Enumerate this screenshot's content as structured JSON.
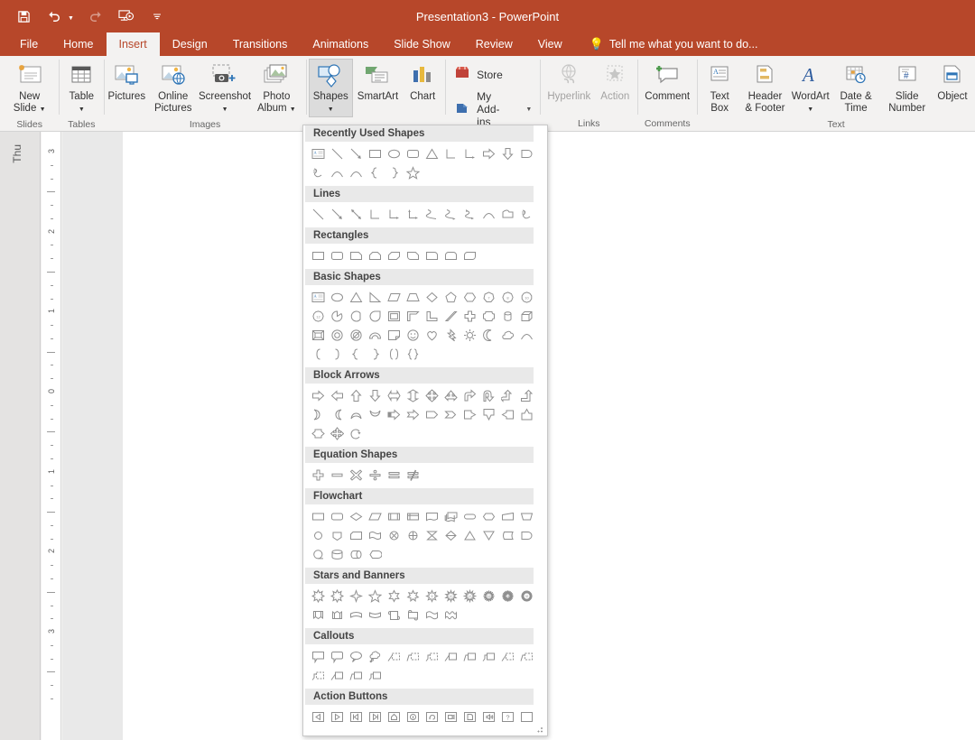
{
  "titlebar": {
    "title": "Presentation3 - PowerPoint",
    "qat": [
      {
        "name": "save-icon",
        "label": "Save"
      },
      {
        "name": "undo-icon",
        "label": "Undo"
      },
      {
        "name": "redo-icon",
        "label": "Redo"
      },
      {
        "name": "start-slideshow-icon",
        "label": "Start From Beginning"
      },
      {
        "name": "customize-qat-icon",
        "label": "Customize Quick Access Toolbar"
      }
    ]
  },
  "tabs": [
    {
      "label": "File",
      "active": false
    },
    {
      "label": "Home",
      "active": false
    },
    {
      "label": "Insert",
      "active": true
    },
    {
      "label": "Design",
      "active": false
    },
    {
      "label": "Transitions",
      "active": false
    },
    {
      "label": "Animations",
      "active": false
    },
    {
      "label": "Slide Show",
      "active": false
    },
    {
      "label": "Review",
      "active": false
    },
    {
      "label": "View",
      "active": false
    }
  ],
  "tellme": "Tell me what you want to do...",
  "ribbon": {
    "groups": [
      {
        "name": "slides",
        "label": "Slides",
        "buttons": [
          {
            "label": "New Slide",
            "caret": true,
            "icon": "new-slide-icon",
            "disabled": false,
            "active": false
          }
        ]
      },
      {
        "name": "tables",
        "label": "Tables",
        "buttons": [
          {
            "label": "Table",
            "caret": true,
            "icon": "table-icon",
            "disabled": false,
            "active": false
          }
        ]
      },
      {
        "name": "images",
        "label": "Images",
        "buttons": [
          {
            "label": "Pictures",
            "caret": false,
            "icon": "pictures-icon",
            "disabled": false,
            "active": false
          },
          {
            "label": "Online Pictures",
            "caret": false,
            "icon": "online-pictures-icon",
            "disabled": false,
            "active": false
          },
          {
            "label": "Screenshot",
            "caret": true,
            "icon": "screenshot-icon",
            "disabled": false,
            "active": false
          },
          {
            "label": "Photo Album",
            "caret": true,
            "icon": "photo-album-icon",
            "disabled": false,
            "active": false
          }
        ]
      },
      {
        "name": "illustrations",
        "label": "",
        "buttons": [
          {
            "label": "Shapes",
            "caret": true,
            "icon": "shapes-icon",
            "disabled": false,
            "active": true
          },
          {
            "label": "SmartArt",
            "caret": false,
            "icon": "smartart-icon",
            "disabled": false,
            "active": false
          },
          {
            "label": "Chart",
            "caret": false,
            "icon": "chart-icon",
            "disabled": false,
            "active": false
          }
        ]
      },
      {
        "name": "addins",
        "label": "",
        "small_buttons": [
          {
            "label": "Store",
            "icon": "store-icon",
            "caret": false
          },
          {
            "label": "My Add-ins",
            "icon": "my-addins-icon",
            "caret": true
          }
        ]
      },
      {
        "name": "links",
        "label": "Links",
        "buttons": [
          {
            "label": "Hyperlink",
            "caret": false,
            "icon": "hyperlink-icon",
            "disabled": true,
            "active": false
          },
          {
            "label": "Action",
            "caret": false,
            "icon": "action-icon",
            "disabled": true,
            "active": false
          }
        ]
      },
      {
        "name": "comments",
        "label": "Comments",
        "buttons": [
          {
            "label": "Comment",
            "caret": false,
            "icon": "comment-icon",
            "disabled": false,
            "active": false
          }
        ]
      },
      {
        "name": "text",
        "label": "Text",
        "buttons": [
          {
            "label": "Text Box",
            "caret": false,
            "icon": "text-box-icon",
            "disabled": false,
            "active": false
          },
          {
            "label": "Header & Footer",
            "caret": false,
            "icon": "header-footer-icon",
            "disabled": false,
            "active": false
          },
          {
            "label": "WordArt",
            "caret": true,
            "icon": "wordart-icon",
            "disabled": false,
            "active": false
          },
          {
            "label": "Date & Time",
            "caret": false,
            "icon": "date-time-icon",
            "disabled": false,
            "active": false
          },
          {
            "label": "Slide Number",
            "caret": false,
            "icon": "slide-number-icon",
            "disabled": false,
            "active": false
          },
          {
            "label": "Object",
            "caret": false,
            "icon": "object-icon",
            "disabled": false,
            "active": false
          }
        ]
      }
    ]
  },
  "workspace": {
    "thumb_pane_label": "Thu",
    "ruler_ticks": [
      "3",
      "2",
      "1",
      "0",
      "1",
      "2",
      "3"
    ]
  },
  "gallery": {
    "sections": [
      {
        "title": "Recently Used Shapes",
        "rows": [
          [
            "text-box",
            "line",
            "line-arrow",
            "rectangle",
            "oval",
            "rounded-rectangle",
            "isosceles-triangle",
            "elbow-connector",
            "elbow-arrow-connector",
            "right-arrow",
            "down-arrow",
            "flowchart-delay"
          ],
          [
            "freeform-scribble",
            "arc",
            "curve",
            "left-brace",
            "right-brace",
            "star-5-point"
          ]
        ]
      },
      {
        "title": "Lines",
        "rows": [
          [
            "line",
            "line-arrow",
            "line-double-arrow",
            "elbow-connector",
            "elbow-arrow-connector",
            "elbow-double-arrow-connector",
            "curved-connector",
            "curved-arrow-connector",
            "curved-double-arrow-connector",
            "curve",
            "freeform-shape",
            "freeform-scribble"
          ]
        ]
      },
      {
        "title": "Rectangles",
        "rows": [
          [
            "rectangle",
            "rounded-rectangle",
            "snip-single-corner-rectangle",
            "snip-same-side-corner-rectangle",
            "snip-diagonal-corner-rectangle",
            "snip-and-round-single-corner-rectangle",
            "round-single-corner-rectangle",
            "round-same-side-corner-rectangle",
            "round-diagonal-corner-rectangle"
          ]
        ]
      },
      {
        "title": "Basic Shapes",
        "rows": [
          [
            "text-box",
            "oval",
            "isosceles-triangle",
            "right-triangle",
            "parallelogram",
            "trapezoid",
            "diamond",
            "pentagon",
            "hexagon",
            "heptagon",
            "octagon",
            "decagon"
          ],
          [
            "dodecagon",
            "pie",
            "chord",
            "teardrop",
            "frame",
            "half-frame",
            "l-shape",
            "diagonal-stripe",
            "cross",
            "plaque",
            "can",
            "cube"
          ],
          [
            "bevel",
            "donut",
            "no-symbol",
            "block-arc",
            "folded-corner",
            "smiley-face",
            "heart",
            "lightning-bolt",
            "sun",
            "moon",
            "cloud",
            "arc"
          ],
          [
            "left-bracket",
            "right-bracket",
            "left-brace",
            "right-brace",
            "double-bracket",
            "double-brace"
          ]
        ]
      },
      {
        "title": "Block Arrows",
        "rows": [
          [
            "right-arrow",
            "left-arrow",
            "up-arrow",
            "down-arrow",
            "left-right-arrow",
            "up-down-arrow",
            "quad-arrow",
            "left-right-up-arrow",
            "bent-arrow",
            "u-turn-arrow",
            "left-up-arrow",
            "bent-up-arrow"
          ],
          [
            "curved-right-arrow",
            "curved-left-arrow",
            "curved-up-arrow",
            "curved-down-arrow",
            "striped-right-arrow",
            "notched-right-arrow",
            "pentagon-arrow",
            "chevron-arrow",
            "right-arrow-callout",
            "down-arrow-callout",
            "left-arrow-callout",
            "up-arrow-callout"
          ],
          [
            "left-right-arrow-callout",
            "quad-arrow-callout",
            "circular-arrow"
          ]
        ]
      },
      {
        "title": "Equation Shapes",
        "rows": [
          [
            "plus-sign",
            "minus-sign",
            "multiply-sign",
            "division-sign",
            "equal-sign",
            "not-equal-sign"
          ]
        ]
      },
      {
        "title": "Flowchart",
        "rows": [
          [
            "flowchart-process",
            "flowchart-alternate-process",
            "flowchart-decision",
            "flowchart-data",
            "flowchart-predefined-process",
            "flowchart-internal-storage",
            "flowchart-document",
            "flowchart-multidocument",
            "flowchart-terminator",
            "flowchart-preparation",
            "flowchart-manual-input",
            "flowchart-manual-operation"
          ],
          [
            "flowchart-connector",
            "flowchart-off-page-connector",
            "flowchart-card",
            "flowchart-punched-tape",
            "flowchart-summing-junction",
            "flowchart-or",
            "flowchart-collate",
            "flowchart-sort",
            "flowchart-extract",
            "flowchart-merge",
            "flowchart-stored-data",
            "flowchart-delay"
          ],
          [
            "flowchart-sequential-access-storage",
            "flowchart-magnetic-disk",
            "flowchart-direct-access-storage",
            "flowchart-display"
          ]
        ]
      },
      {
        "title": "Stars and Banners",
        "rows": [
          [
            "explosion-1",
            "explosion-2",
            "star-4-point",
            "star-5-point",
            "star-6-point",
            "star-7-point",
            "star-8-point",
            "star-10-point",
            "star-12-point",
            "star-16-point",
            "star-24-point",
            "star-32-point"
          ],
          [
            "up-ribbon",
            "down-ribbon",
            "curved-up-ribbon",
            "curved-down-ribbon",
            "vertical-scroll",
            "horizontal-scroll",
            "wave",
            "double-wave"
          ]
        ]
      },
      {
        "title": "Callouts",
        "rows": [
          [
            "rectangular-callout",
            "rounded-rectangular-callout",
            "oval-callout",
            "cloud-callout",
            "line-callout-1",
            "line-callout-2",
            "line-callout-3",
            "line-callout-1-border",
            "line-callout-2-border",
            "line-callout-3-border",
            "line-callout-1-accent",
            "line-callout-2-accent"
          ],
          [
            "line-callout-3-accent",
            "line-callout-1-border-accent",
            "line-callout-2-border-accent",
            "line-callout-3-border-accent"
          ]
        ]
      },
      {
        "title": "Action Buttons",
        "rows": [
          [
            "action-button-back",
            "action-button-forward",
            "action-button-beginning",
            "action-button-end",
            "action-button-home",
            "action-button-information",
            "action-button-return",
            "action-button-movie",
            "action-button-document",
            "action-button-sound",
            "action-button-help",
            "action-button-blank"
          ]
        ]
      }
    ]
  }
}
